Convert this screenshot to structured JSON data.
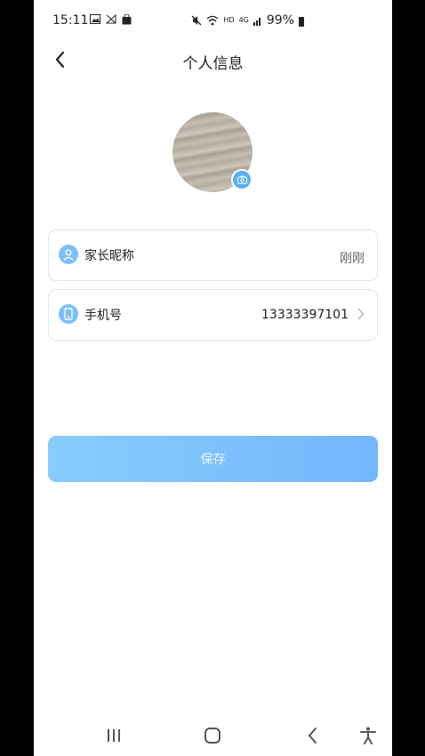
{
  "statusbar": {
    "time": "15:11",
    "hd_label": "HD",
    "network_label": "4G",
    "battery": "99%"
  },
  "header": {
    "title": "个人信息"
  },
  "profile": {
    "nickname_label": "家长昵称",
    "nickname_value": "刚刚",
    "phone_label": "手机号",
    "phone_value": "13333397101"
  },
  "actions": {
    "save_label": "保存"
  },
  "colors": {
    "accent": "#5ab0f6",
    "button_start": "#86cdfc",
    "button_end": "#74b6fb",
    "card_border": "#d7e8f2"
  },
  "icons": [
    "back-icon",
    "camera-icon",
    "user-icon",
    "phone-icon",
    "chevron-right-icon",
    "recent-apps-icon",
    "home-icon",
    "nav-back-icon",
    "accessibility-icon"
  ]
}
